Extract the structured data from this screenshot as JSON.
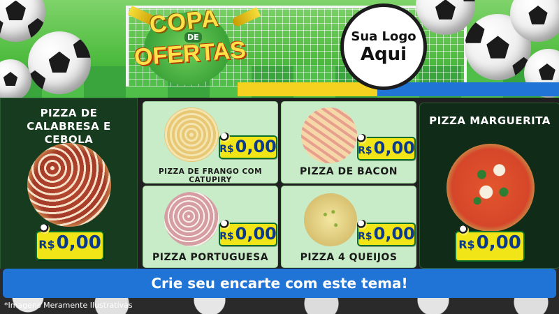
{
  "header": {
    "logo_line1": "COPA",
    "logo_line2": "DE",
    "logo_line3": "OFERTAS",
    "badge_line1": "Sua Logo",
    "badge_line2": "Aqui"
  },
  "currency": "R$",
  "featured": [
    {
      "title": "PIZZA DE CALABRESA E CEBOLA",
      "price": "0,00"
    },
    {
      "title": "PIZZA MARGUERITA",
      "price": "0,00"
    }
  ],
  "items": [
    {
      "title": "PIZZA DE FRANGO COM CATUPIRY",
      "price": "0,00"
    },
    {
      "title": "PIZZA DE BACON",
      "price": "0,00"
    },
    {
      "title": "PIZZA PORTUGUESA",
      "price": "0,00"
    },
    {
      "title": "PIZZA 4 QUEIJOS",
      "price": "0,00"
    }
  ],
  "cta": "Crie seu encarte com este tema!",
  "disclaimer": "*Imagens Meramente Ilustrativas",
  "colors": {
    "price_bg": "#f2e517",
    "price_text": "#0b3a8c",
    "cta_bg": "#1f74d6",
    "tile_bg": "#c9ecc8",
    "side_card_bg": "#173b1f"
  }
}
